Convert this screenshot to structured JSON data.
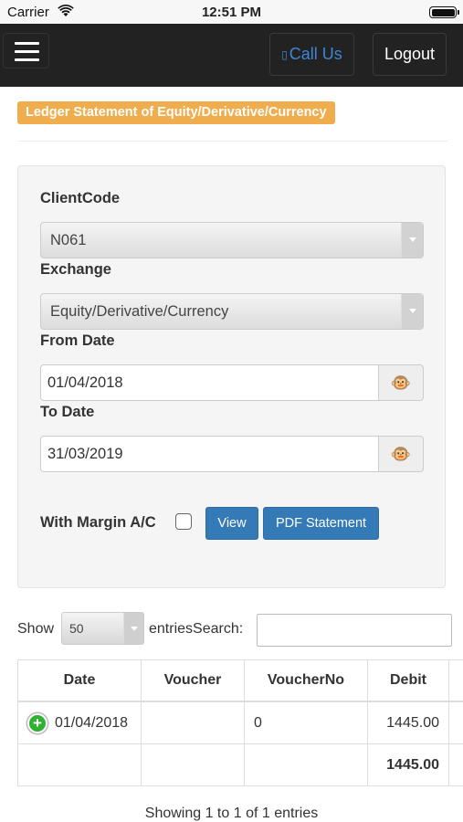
{
  "status_bar": {
    "carrier": "Carrier",
    "time": "12:51 PM",
    "icons": [
      "wifi-icon",
      "battery-icon"
    ]
  },
  "navbar": {
    "menu_icon": "hamburger-icon",
    "call_us": "Call Us",
    "logout": "Logout",
    "accent": "#3f86d6"
  },
  "page": {
    "heading": "Ledger Statement of Equity/Derivative/Currency",
    "heading_color": "#f0ad4e"
  },
  "form": {
    "client_code_label": "ClientCode",
    "client_code_value": "N061",
    "exchange_label": "Exchange",
    "exchange_value": "Equity/Derivative/Currency",
    "from_date_label": "From Date",
    "from_date_value": "01/04/2018",
    "to_date_label": "To Date",
    "to_date_value": "31/03/2019",
    "calendar_icon": "🐵",
    "with_margin_label": "With Margin A/C",
    "with_margin_checked": false,
    "view_button": "View",
    "pdf_button": "PDF Statement",
    "button_color": "#337ab7"
  },
  "table_controls": {
    "show_label": "Show",
    "page_length": "50",
    "entries_label": "entries",
    "search_label": "Search:",
    "search_value": ""
  },
  "table": {
    "columns": [
      "Date",
      "Voucher",
      "VoucherNo",
      "Debit"
    ],
    "rows": [
      {
        "date": "01/04/2018",
        "voucher": "",
        "voucher_no": "0",
        "debit": "1445.00"
      }
    ],
    "total": {
      "debit": "1445.00"
    }
  },
  "footer": {
    "info": "Showing 1 to 1 of 1 entries"
  }
}
